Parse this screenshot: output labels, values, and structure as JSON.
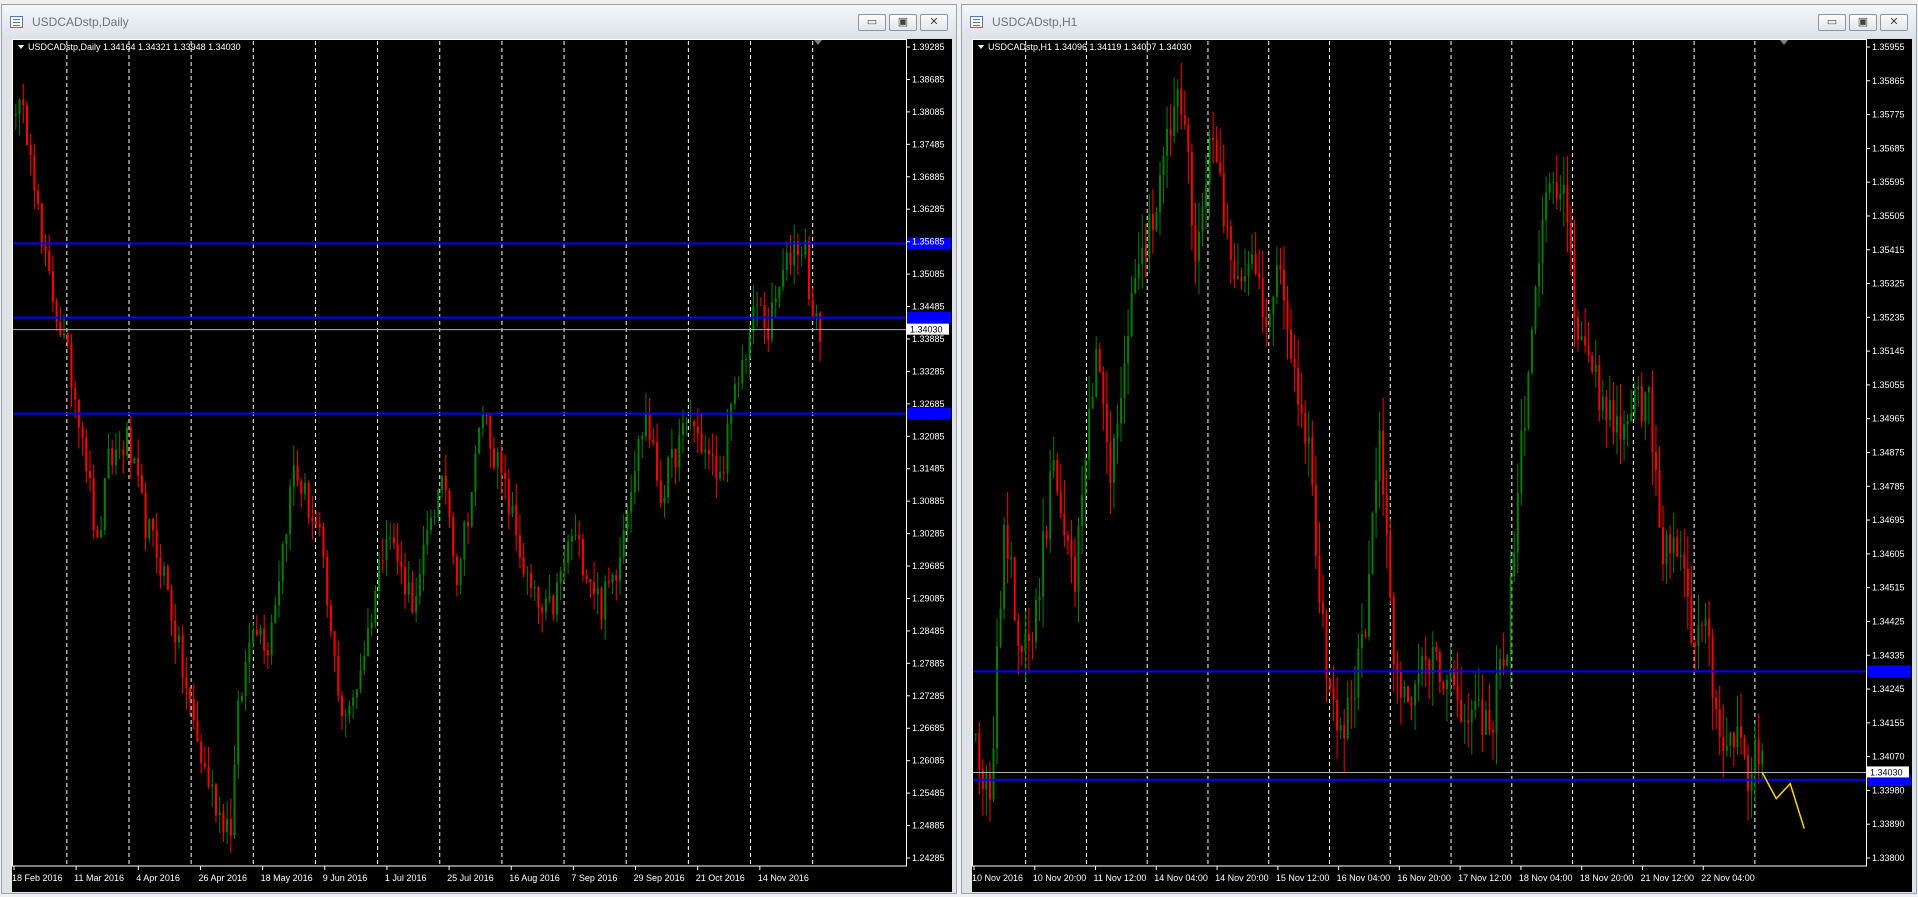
{
  "windows": [
    {
      "title": "USDCADstp,Daily",
      "buttons": {
        "minimize": "▭",
        "maximize": "▣",
        "close": "✕"
      },
      "chart_data": {
        "type": "candlestick",
        "symbol": "USDCADstp",
        "timeframe": "Daily",
        "ohlc_header": "USDCADstp,Daily  1.34164 1.34321 1.33948 1.34030",
        "current_price": "1.34030",
        "ylim": [
          1.2425,
          1.3933
        ],
        "y_ticks": [
          "1.39285",
          "1.38685",
          "1.38085",
          "1.37485",
          "1.36885",
          "1.36285",
          "1.35685",
          "1.35085",
          "1.34485",
          "1.33885",
          "1.33285",
          "1.32685",
          "1.32085",
          "1.31485",
          "1.30885",
          "1.30285",
          "1.29685",
          "1.29085",
          "1.28485",
          "1.27885",
          "1.27285",
          "1.26685",
          "1.26085",
          "1.25485",
          "1.24885",
          "1.24285"
        ],
        "x_ticks": [
          "18 Feb 2016",
          "11 Mar 2016",
          "4 Apr 2016",
          "26 Apr 2016",
          "18 May 2016",
          "9 Jun 2016",
          "1 Jul 2016",
          "25 Jul 2016",
          "16 Aug 2016",
          "7 Sep 2016",
          "29 Sep 2016",
          "21 Oct 2016",
          "14 Nov 2016"
        ],
        "hlines": [
          1.356,
          1.3425,
          1.325
        ],
        "gridlines": true,
        "bull_color": "#008000",
        "bear_color": "#ff0000",
        "line_color": "#0000ff",
        "keypoints": [
          [
            0,
            1.382
          ],
          [
            4,
            1.375
          ],
          [
            7,
            1.355
          ],
          [
            14,
            1.335
          ],
          [
            18,
            1.322
          ],
          [
            22,
            1.3
          ],
          [
            25,
            1.316
          ],
          [
            30,
            1.32
          ],
          [
            35,
            1.305
          ],
          [
            40,
            1.296
          ],
          [
            45,
            1.278
          ],
          [
            50,
            1.262
          ],
          [
            55,
            1.252
          ],
          [
            58,
            1.25
          ],
          [
            60,
            1.27
          ],
          [
            64,
            1.288
          ],
          [
            68,
            1.283
          ],
          [
            71,
            1.296
          ],
          [
            75,
            1.315
          ],
          [
            78,
            1.31
          ],
          [
            82,
            1.302
          ],
          [
            85,
            1.284
          ],
          [
            88,
            1.271
          ],
          [
            90,
            1.27
          ],
          [
            95,
            1.285
          ],
          [
            100,
            1.305
          ],
          [
            104,
            1.296
          ],
          [
            108,
            1.29
          ],
          [
            112,
            1.307
          ],
          [
            116,
            1.312
          ],
          [
            119,
            1.296
          ],
          [
            123,
            1.311
          ],
          [
            126,
            1.326
          ],
          [
            129,
            1.318
          ],
          [
            134,
            1.306
          ],
          [
            138,
            1.294
          ],
          [
            142,
            1.288
          ],
          [
            145,
            1.29
          ],
          [
            150,
            1.303
          ],
          [
            154,
            1.297
          ],
          [
            158,
            1.29
          ],
          [
            162,
            1.297
          ],
          [
            166,
            1.313
          ],
          [
            170,
            1.325
          ],
          [
            174,
            1.31
          ],
          [
            178,
            1.318
          ],
          [
            182,
            1.324
          ],
          [
            186,
            1.318
          ],
          [
            190,
            1.313
          ],
          [
            193,
            1.325
          ],
          [
            197,
            1.337
          ],
          [
            200,
            1.345
          ],
          [
            203,
            1.34
          ],
          [
            206,
            1.348
          ],
          [
            210,
            1.356
          ],
          [
            213,
            1.355
          ],
          [
            215,
            1.342
          ],
          [
            217,
            1.34
          ]
        ]
      }
    },
    {
      "title": "USDCADstp,H1",
      "buttons": {
        "minimize": "▭",
        "maximize": "▣",
        "close": "✕"
      },
      "chart_data": {
        "type": "candlestick",
        "symbol": "USDCADstp",
        "timeframe": "H1",
        "ohlc_header": "USDCADstp,H1  1.34096 1.34119 1.34007 1.34030",
        "current_price": "1.34030",
        "ylim": [
          1.3378,
          1.3599
        ],
        "y_ticks": [
          "1.35955",
          "1.35865",
          "1.35775",
          "1.35685",
          "1.35595",
          "1.35505",
          "1.35415",
          "1.35325",
          "1.35235",
          "1.35145",
          "1.35055",
          "1.34965",
          "1.34875",
          "1.34785",
          "1.34695",
          "1.34605",
          "1.34515",
          "1.34425",
          "1.34335",
          "1.34245",
          "1.34155",
          "1.34070",
          "1.33980",
          "1.33890",
          "1.33800"
        ],
        "x_ticks": [
          "10 Nov 2016",
          "10 Nov 20:00",
          "11 Nov 12:00",
          "14 Nov 04:00",
          "14 Nov 20:00",
          "15 Nov 12:00",
          "16 Nov 04:00",
          "16 Nov 20:00",
          "17 Nov 12:00",
          "18 Nov 04:00",
          "18 Nov 20:00",
          "21 Nov 12:00",
          "22 Nov 04:00"
        ],
        "hlines": [
          1.343,
          1.3401
        ],
        "gridlines": true,
        "bull_color": "#008000",
        "bear_color": "#ff0000",
        "line_color": "#0000ff",
        "projection_color": "#ffd700",
        "projection": [
          [
            1.3403
          ],
          [
            1.3396
          ],
          [
            1.34
          ],
          [
            1.3388
          ]
        ],
        "keypoints": [
          [
            0,
            1.3413
          ],
          [
            4,
            1.3395
          ],
          [
            8,
            1.347
          ],
          [
            12,
            1.344
          ],
          [
            16,
            1.344
          ],
          [
            22,
            1.3485
          ],
          [
            28,
            1.3455
          ],
          [
            34,
            1.3515
          ],
          [
            38,
            1.348
          ],
          [
            44,
            1.353
          ],
          [
            50,
            1.355
          ],
          [
            54,
            1.3575
          ],
          [
            58,
            1.3583
          ],
          [
            62,
            1.3545
          ],
          [
            66,
            1.3572
          ],
          [
            70,
            1.3555
          ],
          [
            74,
            1.3535
          ],
          [
            78,
            1.3545
          ],
          [
            82,
            1.3525
          ],
          [
            86,
            1.354
          ],
          [
            90,
            1.351
          ],
          [
            94,
            1.349
          ],
          [
            98,
            1.344
          ],
          [
            102,
            1.341
          ],
          [
            106,
            1.3425
          ],
          [
            110,
            1.344
          ],
          [
            114,
            1.35
          ],
          [
            118,
            1.343
          ],
          [
            122,
            1.342
          ],
          [
            128,
            1.3435
          ],
          [
            134,
            1.3425
          ],
          [
            140,
            1.342
          ],
          [
            146,
            1.3418
          ],
          [
            150,
            1.344
          ],
          [
            154,
            1.349
          ],
          [
            158,
            1.353
          ],
          [
            162,
            1.356
          ],
          [
            166,
            1.3555
          ],
          [
            170,
            1.352
          ],
          [
            174,
            1.351
          ],
          [
            178,
            1.35
          ],
          [
            182,
            1.3495
          ],
          [
            186,
            1.3505
          ],
          [
            190,
            1.35
          ],
          [
            194,
            1.3462
          ],
          [
            198,
            1.3465
          ],
          [
            202,
            1.344
          ],
          [
            206,
            1.344
          ],
          [
            210,
            1.3415
          ],
          [
            214,
            1.3412
          ],
          [
            218,
            1.3403
          ],
          [
            220,
            1.341
          ],
          [
            222,
            1.3403
          ]
        ]
      }
    }
  ]
}
